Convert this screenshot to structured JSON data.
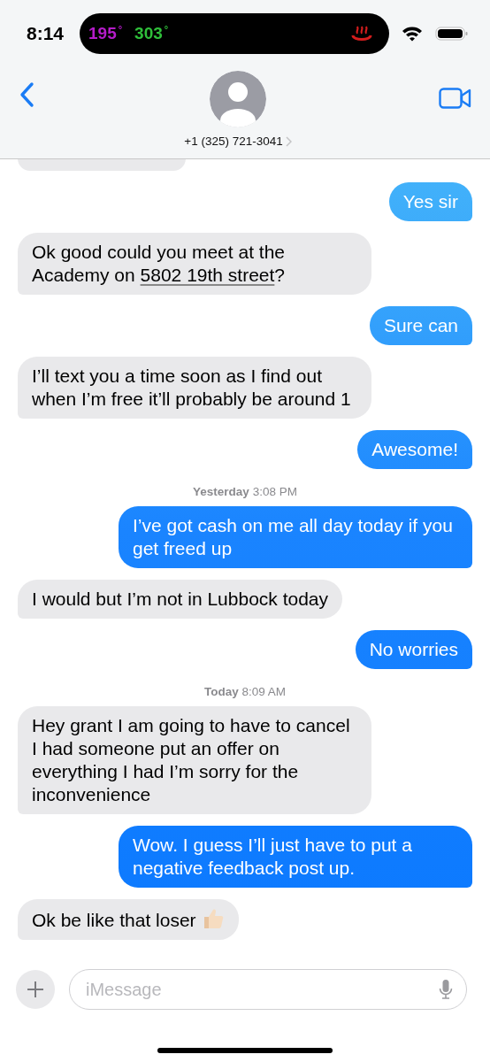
{
  "status_bar": {
    "time": "8:14",
    "island": {
      "readings": [
        {
          "text": "195",
          "unit": "°",
          "color": "#b51cc9"
        },
        {
          "text": "303",
          "unit": "°",
          "color": "#2fbf3a"
        }
      ]
    }
  },
  "header": {
    "contact": "+1 (325) 721-3041"
  },
  "messages": [
    {
      "kind": "cut"
    },
    {
      "kind": "message",
      "sent": true,
      "parts": [
        {
          "text": "Yes sir"
        }
      ]
    },
    {
      "kind": "message",
      "sent": false,
      "parts": [
        {
          "text": "Ok good could you meet at the Academy on "
        },
        {
          "text": "5802 19th street",
          "link": true
        },
        {
          "text": "?"
        }
      ]
    },
    {
      "kind": "message",
      "sent": true,
      "parts": [
        {
          "text": "Sure can"
        }
      ]
    },
    {
      "kind": "message",
      "sent": false,
      "parts": [
        {
          "text": "I’ll text you a time soon as I find out when I’m free it’ll probably be around 1"
        }
      ]
    },
    {
      "kind": "message",
      "sent": true,
      "parts": [
        {
          "text": "Awesome!"
        }
      ]
    },
    {
      "kind": "timestamp",
      "text": "**Yesterday** 3:08 PM"
    },
    {
      "kind": "message",
      "sent": true,
      "parts": [
        {
          "text": "I’ve got cash on me all day today if you get freed up"
        }
      ]
    },
    {
      "kind": "message",
      "sent": false,
      "parts": [
        {
          "text": "I would but I’m not in Lubbock today"
        }
      ]
    },
    {
      "kind": "message",
      "sent": true,
      "parts": [
        {
          "text": "No worries"
        }
      ]
    },
    {
      "kind": "timestamp",
      "text": "**Today** 8:09 AM"
    },
    {
      "kind": "message",
      "sent": false,
      "parts": [
        {
          "text": "Hey grant I am going to have to cancel I had someone put an offer on everything I had I’m sorry for the inconvenience"
        }
      ]
    },
    {
      "kind": "message",
      "sent": true,
      "parts": [
        {
          "text": "Wow. I guess I’ll just have to put a negative feedback post up."
        }
      ]
    },
    {
      "kind": "message",
      "sent": false,
      "parts": [
        {
          "text": "Ok be like that loser"
        }
      ],
      "thumbs_up": true
    }
  ],
  "composer": {
    "placeholder": "iMessage"
  }
}
